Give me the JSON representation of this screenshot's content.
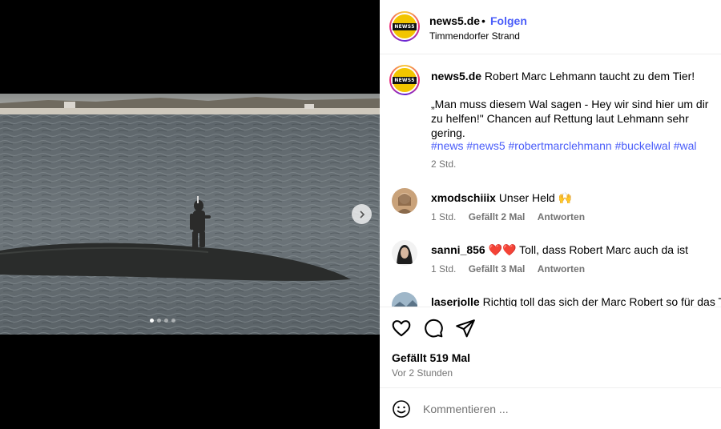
{
  "post": {
    "username": "news5.de",
    "separator": "•",
    "follow_label": "Folgen",
    "location": "Timmendorfer Strand",
    "avatar_text": "NEWS5",
    "caption_text": "Robert Marc Lehmann taucht zu dem Tier!",
    "caption_quote": "„Man muss diesem Wal sagen - Hey wir sind hier um dir zu helfen!\" Chancen auf Rettung laut Lehmann sehr gering.",
    "hashtags": "#news #news5 #robertmarclehmann #buckelwal #wal",
    "caption_time": "2 Std.",
    "carousel_count": 4,
    "carousel_index": 0
  },
  "comments": [
    {
      "username": "xmodschiiix",
      "text": "Unser Held 🙌",
      "time": "1 Std.",
      "likes": "Gefällt 2 Mal",
      "reply": "Antworten"
    },
    {
      "username": "sanni_856",
      "text": "❤️❤️ Toll, dass Robert Marc auch da ist",
      "time": "1 Std.",
      "likes": "Gefällt 3 Mal",
      "reply": "Antworten"
    },
    {
      "username": "laserjolle",
      "text": "Richtig toll das sich der Marc Robert so für das Tier",
      "time": "",
      "likes": "",
      "reply": ""
    }
  ],
  "actions": {
    "icons": [
      "heart-icon",
      "comment-icon",
      "share-icon"
    ],
    "likes_label": "Gefällt 519 Mal",
    "posted_ago": "Vor 2 Stunden"
  },
  "comment_box": {
    "placeholder": "Kommentieren ...",
    "icon": "emoji-icon"
  },
  "colors": {
    "link_blue": "#4a5df9",
    "muted": "#737373",
    "brand_yellow": "#f2c500"
  }
}
